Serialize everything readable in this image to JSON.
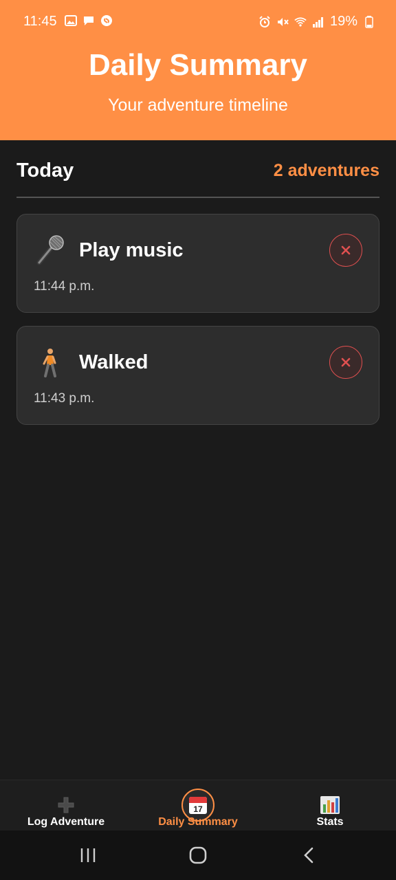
{
  "status": {
    "time": "11:45",
    "battery": "19%",
    "left_icons": [
      "gallery-icon",
      "chat-icon",
      "shazam-icon"
    ],
    "right_icons": [
      "alarm-icon",
      "mute-icon",
      "wifi-icon",
      "signal-icon",
      "battery-icon"
    ]
  },
  "header": {
    "title": "Daily Summary",
    "subtitle": "Your adventure timeline",
    "color": "#ff8f45"
  },
  "section": {
    "title": "Today",
    "count": "2 adventures"
  },
  "entries": [
    {
      "icon": "microphone-icon",
      "title": "Play music",
      "time": "11:44 p.m."
    },
    {
      "icon": "walking-person-icon",
      "title": "Walked",
      "time": "11:43 p.m."
    }
  ],
  "tabs": [
    {
      "label": "Log Adventure",
      "icon": "plus-icon",
      "active": false
    },
    {
      "label": "Daily Summary",
      "icon": "calendar-icon",
      "active": true,
      "icon_text": "17"
    },
    {
      "label": "Stats",
      "icon": "bar-chart-icon",
      "active": false
    }
  ],
  "colors": {
    "accent": "#ff8f45",
    "background": "#1b1b1b",
    "card": "#2d2d2d",
    "delete": "#e05050"
  }
}
